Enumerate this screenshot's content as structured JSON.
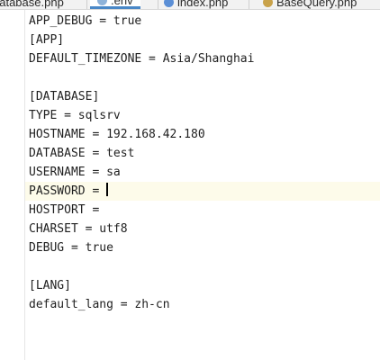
{
  "tabs": [
    {
      "label": "database.php",
      "icon": "php-file-icon",
      "active": false
    },
    {
      "label": ".env",
      "icon": "env-file-icon",
      "active": true
    },
    {
      "label": "index.php",
      "icon": "php-file-icon",
      "active": false
    },
    {
      "label": "BaseQuery.php",
      "icon": "php-file-icon",
      "active": false
    }
  ],
  "editor": {
    "current_line_color": "#fdfbea",
    "lines": [
      "APP_DEBUG = true",
      "[APP]",
      "DEFAULT_TIMEZONE = Asia/Shanghai",
      "",
      "[DATABASE]",
      "TYPE = sqlsrv",
      "HOSTNAME = 192.168.42.180",
      "DATABASE = test",
      "USERNAME = sa",
      "PASSWORD = ",
      "HOSTPORT =",
      "CHARSET = utf8",
      "DEBUG = true",
      "",
      "[LANG]",
      "default_lang = zh-cn"
    ]
  }
}
